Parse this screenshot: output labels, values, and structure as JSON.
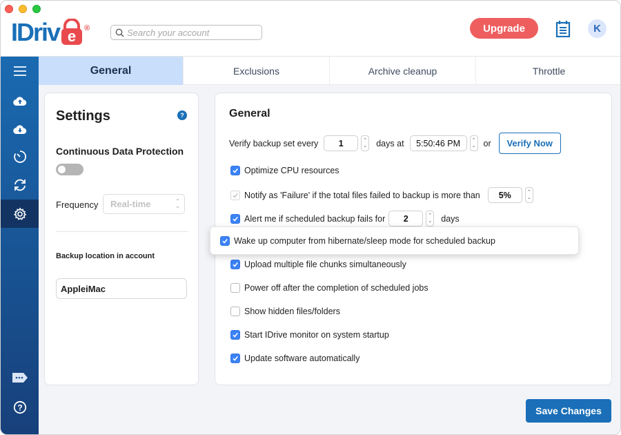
{
  "app": {
    "logo_text": "IDriv",
    "logo_suffix": "e",
    "registered": "®"
  },
  "header": {
    "search_placeholder": "Search your account",
    "upgrade_label": "Upgrade",
    "avatar_initial": "K"
  },
  "sidebar": {
    "items": [
      {
        "name": "menu",
        "icon": "hamburger-icon"
      },
      {
        "name": "backup",
        "icon": "cloud-upload-icon"
      },
      {
        "name": "restore",
        "icon": "cloud-download-icon"
      },
      {
        "name": "scheduler",
        "icon": "clock-icon"
      },
      {
        "name": "sync",
        "icon": "sync-icon"
      },
      {
        "name": "settings",
        "icon": "gear-icon",
        "active": true
      },
      {
        "name": "feedback",
        "icon": "chat-tag-icon"
      },
      {
        "name": "help",
        "icon": "help-icon"
      }
    ]
  },
  "tabs": [
    {
      "label": "General",
      "active": true
    },
    {
      "label": "Exclusions"
    },
    {
      "label": "Archive cleanup"
    },
    {
      "label": "Throttle"
    }
  ],
  "left_panel": {
    "title": "Settings",
    "help": "?",
    "cdp_label": "Continuous Data Protection",
    "cdp_enabled": false,
    "frequency_label": "Frequency",
    "frequency_value": "Real-time",
    "backup_location_label": "Backup location in account",
    "backup_location_value": "AppleiMac"
  },
  "general": {
    "title": "General",
    "verify": {
      "prefix": "Verify backup set every",
      "days_value": "1",
      "days_at": "days at",
      "time_value": "5:50:46 PM",
      "or": "or",
      "verify_now_label": "Verify Now"
    },
    "optimize_cpu": {
      "label": "Optimize CPU resources",
      "checked": true
    },
    "notify_failure": {
      "label": "Notify as 'Failure' if the total files failed to backup is more than",
      "checked": true,
      "disabled": true,
      "percent_value": "5%"
    },
    "alert": {
      "label": "Alert me if scheduled backup fails for",
      "checked": true,
      "days_value": "2",
      "suffix": "days"
    },
    "wake_up": {
      "label": "Wake up computer from hibernate/sleep mode for scheduled backup",
      "checked": true
    },
    "upload_chunks": {
      "label": "Upload multiple file chunks simultaneously",
      "checked": true
    },
    "power_off": {
      "label": "Power off after the completion of scheduled jobs",
      "checked": false
    },
    "show_hidden": {
      "label": "Show hidden files/folders",
      "checked": false
    },
    "start_monitor": {
      "label": "Start IDrive monitor on system startup",
      "checked": true
    },
    "update_software": {
      "label": "Update software automatically",
      "checked": true
    }
  },
  "footer": {
    "save_label": "Save Changes"
  },
  "colors": {
    "brand_blue": "#1a6fb8",
    "upgrade_red": "#ef5e5f",
    "active_tab": "#c9defb",
    "checkbox_blue": "#3b82f6"
  }
}
